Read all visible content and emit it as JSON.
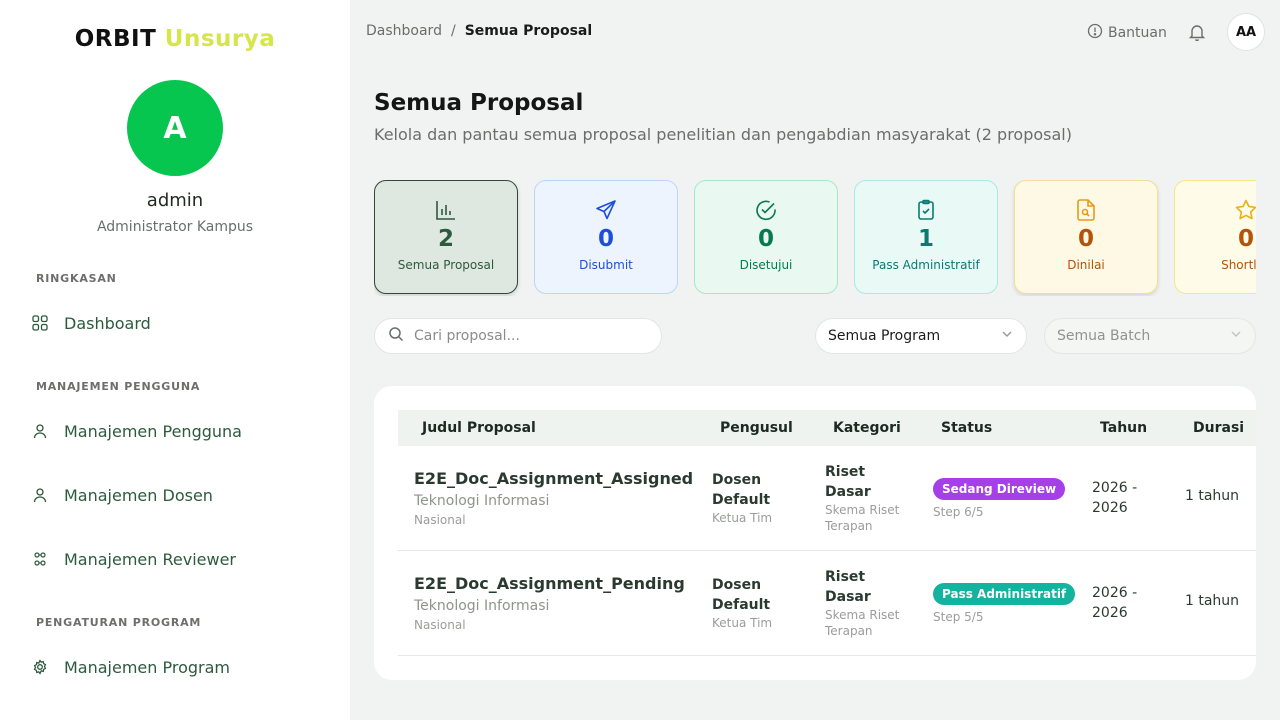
{
  "brand": {
    "part1": "ORBIT",
    "part2": "Unsurya"
  },
  "user": {
    "initial": "A",
    "name": "admin",
    "role": "Administrator Kampus"
  },
  "sidebar": {
    "sections": [
      "RINGKASAN",
      "MANAJEMEN PENGGUNA",
      "PENGATURAN PROGRAM"
    ],
    "items": [
      {
        "label": "Dashboard",
        "icon": "grid-icon"
      },
      {
        "label": "Manajemen Pengguna",
        "icon": "user-icon"
      },
      {
        "label": "Manajemen Dosen",
        "icon": "user-icon"
      },
      {
        "label": "Manajemen Reviewer",
        "icon": "users-network-icon"
      },
      {
        "label": "Manajemen Program",
        "icon": "gear-icon"
      }
    ]
  },
  "header": {
    "breadcrumb": [
      "Dashboard",
      "/",
      "Semua Proposal"
    ],
    "help_label": "Bantuan",
    "avatar_initials": "AA"
  },
  "page": {
    "title": "Semua Proposal",
    "subtitle": "Kelola dan pantau semua proposal penelitian dan pengabdian masyarakat (2 proposal)"
  },
  "stats": [
    {
      "value": "2",
      "label": "Semua Proposal",
      "icon": "bar-chart-icon",
      "color": "#2d5a3d",
      "bg": "#dfe7e1",
      "border": "#2f4a38"
    },
    {
      "value": "0",
      "label": "Disubmit",
      "icon": "send-icon",
      "color": "#1d4fd8",
      "bg": "#edf4fe",
      "border": "#bcd5f6"
    },
    {
      "value": "0",
      "label": "Disetujui",
      "icon": "check-circle-icon",
      "color": "#067a52",
      "bg": "#e9f8f1",
      "border": "#a7e6cc"
    },
    {
      "value": "1",
      "label": "Pass Administratif",
      "icon": "clipboard-check-icon",
      "color": "#0b7a72",
      "bg": "#e9f9f6",
      "border": "#a9e9de"
    },
    {
      "value": "0",
      "label": "Dinilai",
      "icon": "file-search-icon",
      "color": "#b4530a",
      "bg": "#fdf9e4",
      "border": "#f1df98"
    },
    {
      "value": "0",
      "label": "Shortlist",
      "icon": "star-icon",
      "color": "#b4530a",
      "bg": "#fefbe8",
      "border": "#f5e58e"
    }
  ],
  "filters": {
    "search_placeholder": "Cari proposal...",
    "program_value": "Semua Program",
    "batch_value": "Semua Batch"
  },
  "table": {
    "columns": [
      "Judul Proposal",
      "Pengusul",
      "Kategori",
      "Status",
      "Tahun",
      "Durasi"
    ],
    "rows": [
      {
        "title": "E2E_Doc_Assignment_Assigned",
        "field": "Teknologi Informasi",
        "scope": "Nasional",
        "pengusul": "Dosen Default",
        "pengusul_role": "Ketua Tim",
        "kategori": "Riset Dasar",
        "skema": "Skema Riset Terapan",
        "status": "Sedang Direview",
        "status_color": "#a540e8",
        "step": "Step 6/5",
        "tahun": "2026 - 2026",
        "durasi": "1 tahun"
      },
      {
        "title": "E2E_Doc_Assignment_Pending",
        "field": "Teknologi Informasi",
        "scope": "Nasional",
        "pengusul": "Dosen Default",
        "pengusul_role": "Ketua Tim",
        "kategori": "Riset Dasar",
        "skema": "Skema Riset Terapan",
        "status": "Pass Administratif",
        "status_color": "#14b3a0",
        "step": "Step 5/5",
        "tahun": "2026 - 2026",
        "durasi": "1 tahun"
      }
    ]
  }
}
